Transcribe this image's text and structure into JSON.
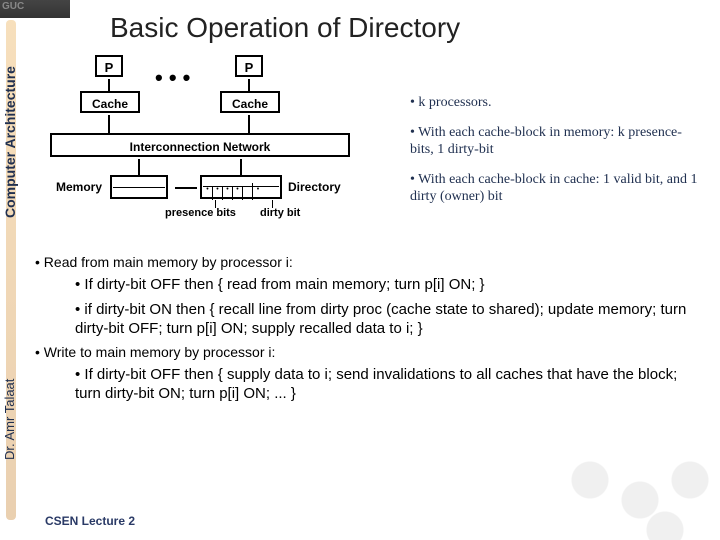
{
  "logo_text": "GUC",
  "title": "Basic Operation of Directory",
  "side_left": "Computer Architecture",
  "side_author": "Dr. Amr Talaat",
  "diagram": {
    "p_label": "P",
    "cache_label": "Cache",
    "dots": "• • •",
    "interconnect": "Interconnection Network",
    "memory_label": "Memory",
    "directory_label": "Directory",
    "presence_label": "presence bits",
    "dirty_label": "dirty bit"
  },
  "upper_bullets": [
    "k processors.",
    "With each cache-block in memory: k presence-bits, 1 dirty-bit",
    "With each cache-block in cache: 1 valid bit, and 1 dirty (owner) bit"
  ],
  "lower": {
    "read_header": "• Read from main memory by processor i:",
    "read_off": "• If dirty-bit OFF then { read from main memory; turn p[i] ON; }",
    "read_on": "• if dirty-bit ON   then { recall line from dirty proc (cache state to shared); update memory; turn dirty-bit OFF; turn p[i] ON; supply recalled data to i; }",
    "write_header": "• Write to main memory by processor i:",
    "write_off": "• If dirty-bit OFF then { supply data to i; send invalidations to all caches that have the block; turn dirty-bit ON; turn p[i] ON; ... }"
  },
  "footer": "CSEN Lecture  2"
}
